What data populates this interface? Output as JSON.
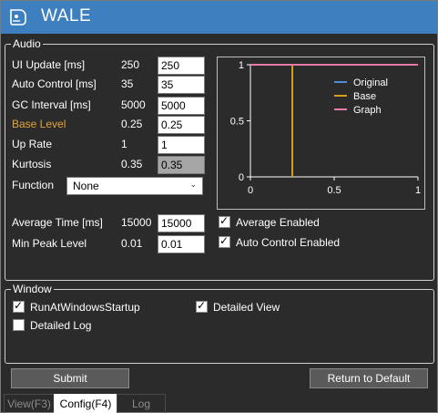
{
  "window": {
    "title": "WALE"
  },
  "audio": {
    "group_label": "Audio",
    "rows": [
      {
        "label": "UI Update [ms]",
        "value": "250",
        "input": "250"
      },
      {
        "label": "Auto Control [ms]",
        "value": "35",
        "input": "35"
      },
      {
        "label": "GC Interval [ms]",
        "value": "5000",
        "input": "5000"
      },
      {
        "label": "Base Level",
        "value": "0.25",
        "input": "0.25"
      },
      {
        "label": "Up Rate",
        "value": "1",
        "input": "1"
      },
      {
        "label": "Kurtosis",
        "value": "0.35",
        "input": "0.35"
      }
    ],
    "function_label": "Function",
    "function_value": "None",
    "average_time": {
      "label": "Average Time [ms]",
      "value": "15000",
      "input": "15000"
    },
    "min_peak": {
      "label": "Min Peak Level",
      "value": "0.01",
      "input": "0.01"
    },
    "average_enabled": {
      "label": "Average Enabled",
      "checked": true
    },
    "auto_control_enabled": {
      "label": "Auto Control Enabled",
      "checked": true
    }
  },
  "chart_data": {
    "type": "line",
    "title": "",
    "xlabel": "",
    "ylabel": "",
    "xlim": [
      0,
      1
    ],
    "ylim": [
      0,
      1
    ],
    "xticks": [
      "0",
      "0.5",
      "1"
    ],
    "yticks": [
      "0",
      "0.5",
      "1"
    ],
    "legend_position": "top-right",
    "grid": false,
    "series": [
      {
        "name": "Original",
        "color": "#4a90d9",
        "points": [
          [
            0,
            1
          ],
          [
            1,
            1
          ]
        ]
      },
      {
        "name": "Base",
        "color": "#d4a017",
        "points": [
          [
            0.25,
            0
          ],
          [
            0.25,
            1
          ]
        ]
      },
      {
        "name": "Graph",
        "color": "#e87aa8",
        "points": [
          [
            0,
            1
          ],
          [
            1,
            1
          ]
        ]
      }
    ]
  },
  "window_group": {
    "group_label": "Window",
    "run_at_startup": {
      "label": "RunAtWindowsStartup",
      "checked": true
    },
    "detailed_view": {
      "label": "Detailed View",
      "checked": true
    },
    "detailed_log": {
      "label": "Detailed Log",
      "checked": false
    }
  },
  "buttons": {
    "submit": "Submit",
    "return_default": "Return to Default"
  },
  "tabs": [
    {
      "label": "View(F3)",
      "active": false
    },
    {
      "label": "Config(F4)",
      "active": true
    },
    {
      "label": "Log",
      "active": false
    }
  ]
}
